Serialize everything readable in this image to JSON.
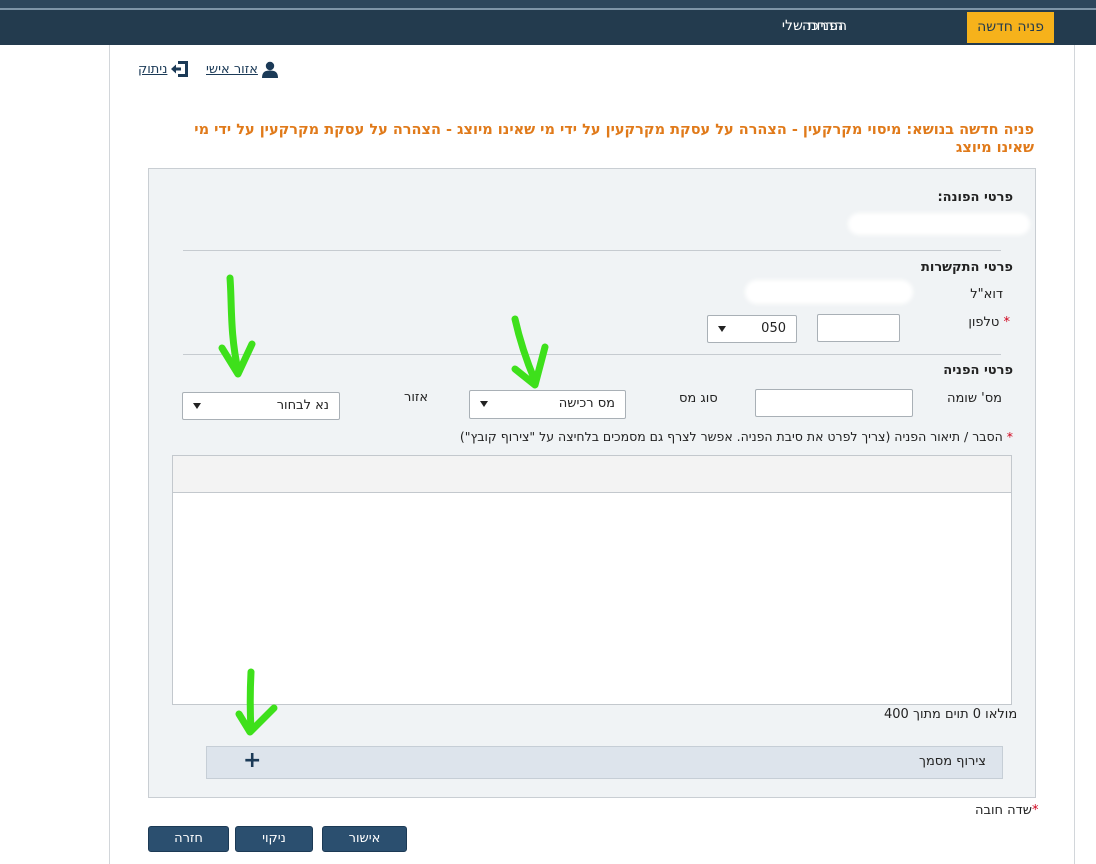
{
  "nav": {
    "new_inquiry": "פניה חדשה",
    "my_inquiries": "הפניות שלי",
    "guide": "הדרכה"
  },
  "user": {
    "personal_area": "אזור אישי",
    "disconnect": "ניתוק"
  },
  "title": "פניה חדשה בנושא: מיסוי מקרקעין - הצהרה על עסקת מקרקעין על ידי מי שאינו מיוצג - הצהרה על עסקת מקרקעין על ידי מי שאינו מיוצג",
  "applicant": {
    "section_label": "פרטי הפונה:"
  },
  "contact": {
    "section_label": "פרטי התקשרות",
    "email_label": "דוא\"ל",
    "phone_label": "טלפון",
    "phone_prefix": "050",
    "phone_value": ""
  },
  "inquiry": {
    "section_label": "פרטי הפניה",
    "assessor_label": "מס' שומה",
    "tax_type_label": "סוג מס",
    "tax_type_value": "מס רכישה",
    "region_label": "אזור",
    "region_value": "נא לבחור",
    "description_label": "הסבר / תיאור הפניה (צריך לפרט את סיבת הפניה. אפשר לצרף גם מסמכים בלחיצה על \"צירוף קובץ\")",
    "char_count": "מולאו 0 תוים מתוך 400",
    "attach_label": "צירוף מסמך",
    "attach_icon": "+"
  },
  "footer": {
    "required_note": "שדה חובה",
    "required_mark": "*",
    "confirm": "אישור",
    "clear": "ניקוי",
    "back": "חזרה"
  },
  "colors": {
    "nav_bg": "#233b4e",
    "nav_active": "#f6b21b",
    "title": "#e07a1a",
    "button": "#2b4f6f",
    "annotation_arrow": "#3ee01b"
  }
}
